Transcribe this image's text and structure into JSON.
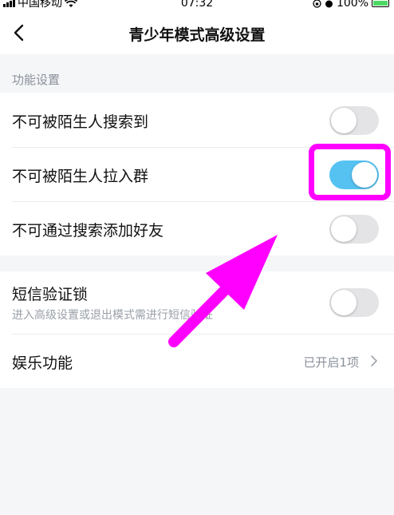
{
  "status_bar": {
    "carrier": "中国移动",
    "time": "07:32",
    "battery": "100%"
  },
  "nav": {
    "title": "青少年模式高级设置"
  },
  "section": {
    "header": "功能设置"
  },
  "settings_group": [
    {
      "label": "不可被陌生人搜索到",
      "enabled": false
    },
    {
      "label": "不可被陌生人拉入群",
      "enabled": true
    },
    {
      "label": "不可通过搜索添加好友",
      "enabled": false
    }
  ],
  "sms_lock": {
    "label": "短信验证锁",
    "description": "进入高级设置或退出模式需进行短信验证",
    "enabled": false
  },
  "entertainment": {
    "label": "娱乐功能",
    "value": "已开启1项"
  },
  "colors": {
    "toggle_on": "#56c2f2",
    "toggle_off": "#e4e4e6",
    "annotation": "#ff00ff"
  }
}
